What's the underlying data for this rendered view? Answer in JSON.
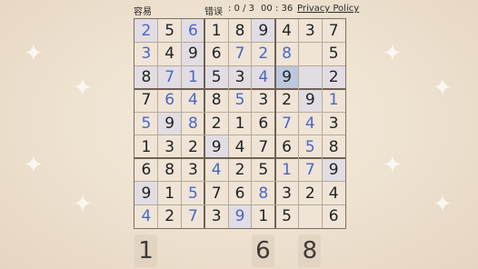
{
  "header": {
    "difficulty": "容易",
    "errors_label": "错误",
    "errors_count": ": 0 / 3",
    "timer": "00 : 36",
    "privacy_link": "Privacy Policy"
  },
  "board": {
    "rows": [
      [
        {
          "v": "2",
          "t": "user",
          "bg": "hl"
        },
        {
          "v": "5",
          "t": "given",
          "bg": ""
        },
        {
          "v": "6",
          "t": "user",
          "bg": "hl"
        },
        {
          "v": "1",
          "t": "given",
          "bg": ""
        },
        {
          "v": "8",
          "t": "given",
          "bg": ""
        },
        {
          "v": "9",
          "t": "given",
          "bg": "hl"
        },
        {
          "v": "4",
          "t": "given",
          "bg": ""
        },
        {
          "v": "3",
          "t": "given",
          "bg": ""
        },
        {
          "v": "7",
          "t": "given",
          "bg": ""
        }
      ],
      [
        {
          "v": "3",
          "t": "user",
          "bg": ""
        },
        {
          "v": "4",
          "t": "given",
          "bg": ""
        },
        {
          "v": "9",
          "t": "given",
          "bg": "hl"
        },
        {
          "v": "6",
          "t": "given",
          "bg": ""
        },
        {
          "v": "7",
          "t": "user",
          "bg": ""
        },
        {
          "v": "2",
          "t": "user",
          "bg": ""
        },
        {
          "v": "8",
          "t": "user",
          "bg": ""
        },
        {
          "v": "",
          "t": "",
          "bg": ""
        },
        {
          "v": "5",
          "t": "given",
          "bg": ""
        }
      ],
      [
        {
          "v": "8",
          "t": "given",
          "bg": "hl"
        },
        {
          "v": "7",
          "t": "user",
          "bg": "hl"
        },
        {
          "v": "1",
          "t": "user",
          "bg": "hl"
        },
        {
          "v": "5",
          "t": "given",
          "bg": "hl"
        },
        {
          "v": "3",
          "t": "given",
          "bg": "hl"
        },
        {
          "v": "4",
          "t": "user",
          "bg": "hl"
        },
        {
          "v": "9",
          "t": "given",
          "bg": "sel"
        },
        {
          "v": "",
          "t": "",
          "bg": "hl"
        },
        {
          "v": "2",
          "t": "given",
          "bg": "hl"
        }
      ],
      [
        {
          "v": "7",
          "t": "given",
          "bg": ""
        },
        {
          "v": "6",
          "t": "user",
          "bg": ""
        },
        {
          "v": "4",
          "t": "user",
          "bg": ""
        },
        {
          "v": "8",
          "t": "given",
          "bg": ""
        },
        {
          "v": "5",
          "t": "user",
          "bg": ""
        },
        {
          "v": "3",
          "t": "given",
          "bg": ""
        },
        {
          "v": "2",
          "t": "given",
          "bg": ""
        },
        {
          "v": "9",
          "t": "given",
          "bg": "hl"
        },
        {
          "v": "1",
          "t": "user",
          "bg": ""
        }
      ],
      [
        {
          "v": "5",
          "t": "user",
          "bg": ""
        },
        {
          "v": "9",
          "t": "given",
          "bg": "hl"
        },
        {
          "v": "8",
          "t": "user",
          "bg": ""
        },
        {
          "v": "2",
          "t": "given",
          "bg": ""
        },
        {
          "v": "1",
          "t": "given",
          "bg": ""
        },
        {
          "v": "6",
          "t": "given",
          "bg": ""
        },
        {
          "v": "7",
          "t": "user",
          "bg": ""
        },
        {
          "v": "4",
          "t": "user",
          "bg": ""
        },
        {
          "v": "3",
          "t": "given",
          "bg": ""
        }
      ],
      [
        {
          "v": "1",
          "t": "given",
          "bg": ""
        },
        {
          "v": "3",
          "t": "given",
          "bg": ""
        },
        {
          "v": "2",
          "t": "given",
          "bg": ""
        },
        {
          "v": "9",
          "t": "given",
          "bg": "hl"
        },
        {
          "v": "4",
          "t": "given",
          "bg": ""
        },
        {
          "v": "7",
          "t": "given",
          "bg": ""
        },
        {
          "v": "6",
          "t": "given",
          "bg": ""
        },
        {
          "v": "5",
          "t": "user",
          "bg": ""
        },
        {
          "v": "8",
          "t": "given",
          "bg": ""
        }
      ],
      [
        {
          "v": "6",
          "t": "given",
          "bg": ""
        },
        {
          "v": "8",
          "t": "given",
          "bg": ""
        },
        {
          "v": "3",
          "t": "given",
          "bg": ""
        },
        {
          "v": "4",
          "t": "user",
          "bg": ""
        },
        {
          "v": "2",
          "t": "given",
          "bg": ""
        },
        {
          "v": "5",
          "t": "given",
          "bg": ""
        },
        {
          "v": "1",
          "t": "user",
          "bg": ""
        },
        {
          "v": "7",
          "t": "user",
          "bg": ""
        },
        {
          "v": "9",
          "t": "given",
          "bg": "hl"
        }
      ],
      [
        {
          "v": "9",
          "t": "given",
          "bg": "hl"
        },
        {
          "v": "1",
          "t": "given",
          "bg": ""
        },
        {
          "v": "5",
          "t": "user",
          "bg": ""
        },
        {
          "v": "7",
          "t": "given",
          "bg": ""
        },
        {
          "v": "6",
          "t": "given",
          "bg": ""
        },
        {
          "v": "8",
          "t": "user",
          "bg": ""
        },
        {
          "v": "3",
          "t": "given",
          "bg": ""
        },
        {
          "v": "2",
          "t": "given",
          "bg": ""
        },
        {
          "v": "4",
          "t": "given",
          "bg": ""
        }
      ],
      [
        {
          "v": "4",
          "t": "user",
          "bg": ""
        },
        {
          "v": "2",
          "t": "given",
          "bg": ""
        },
        {
          "v": "7",
          "t": "user",
          "bg": ""
        },
        {
          "v": "3",
          "t": "given",
          "bg": ""
        },
        {
          "v": "9",
          "t": "user",
          "bg": "hl"
        },
        {
          "v": "1",
          "t": "given",
          "bg": ""
        },
        {
          "v": "5",
          "t": "given",
          "bg": ""
        },
        {
          "v": "",
          "t": "",
          "bg": ""
        },
        {
          "v": "6",
          "t": "given",
          "bg": ""
        }
      ]
    ]
  },
  "number_pad": [
    {
      "label": "1",
      "col": 0
    },
    {
      "label": "6",
      "col": 5
    },
    {
      "label": "8",
      "col": 7
    }
  ],
  "colors": {
    "user_digit": "#4a66c6",
    "given_digit": "#222222",
    "highlight": "#e2dde4",
    "selected": "#bcc8dd"
  }
}
